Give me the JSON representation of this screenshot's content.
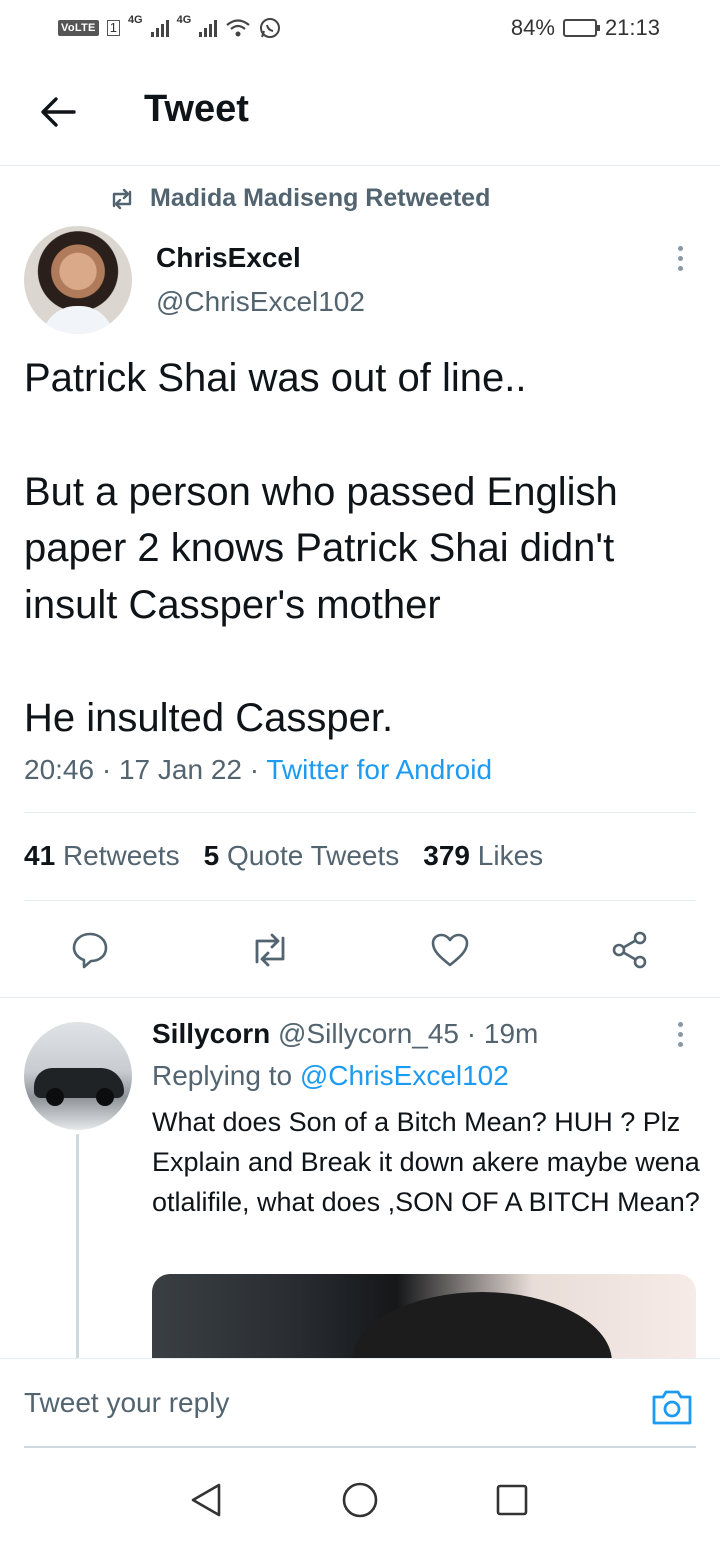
{
  "status_bar": {
    "volte": "VoLTE",
    "sim_slot": "1",
    "net1": "4G",
    "net2": "4G",
    "battery": "84%",
    "battery_level": 0.84,
    "time": "21:13"
  },
  "header": {
    "title": "Tweet"
  },
  "retweet": {
    "label": "Madida Madiseng Retweeted"
  },
  "tweet": {
    "author_name": "ChrisExcel",
    "author_handle": "@ChrisExcel102",
    "paragraphs": [
      "Patrick Shai was out of line..",
      "But a person who passed English paper 2 knows Patrick Shai didn't insult Cassper's mother",
      "He insulted Cassper."
    ],
    "time": "20:46",
    "date": "17 Jan 22",
    "separator": "·",
    "source": "Twitter for Android",
    "stats": {
      "retweets_count": "41",
      "retweets_label": "Retweets",
      "quotes_count": "5",
      "quotes_label": "Quote Tweets",
      "likes_count": "379",
      "likes_label": "Likes"
    }
  },
  "reply": {
    "name": "Sillycorn",
    "handle": "@Sillycorn_45",
    "separator": "·",
    "age": "19m",
    "replying_label": "Replying to",
    "replying_to": "@ChrisExcel102",
    "text": "What does Son of a Bitch Mean? HUH ? Plz Explain and Break it down akere maybe wena otlalifile, what does ,SON OF A BITCH Mean?"
  },
  "composer": {
    "placeholder": "Tweet your reply"
  },
  "colors": {
    "accent": "#1d9bf0",
    "text": "#0f1419",
    "muted": "#536471"
  }
}
